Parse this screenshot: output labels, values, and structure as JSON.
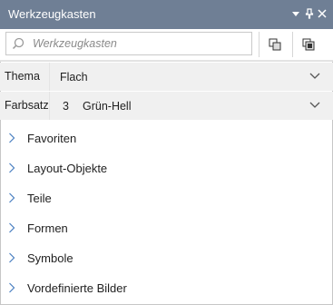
{
  "window": {
    "title": "Werkzeugkasten"
  },
  "search": {
    "placeholder": "Werkzeugkasten"
  },
  "properties": [
    {
      "label": "Thema",
      "value": "Flach"
    },
    {
      "label": "Farbsatz",
      "number": "3",
      "value": "Grün-Hell"
    }
  ],
  "categories": [
    {
      "label": "Favoriten"
    },
    {
      "label": "Layout-Objekte"
    },
    {
      "label": "Teile"
    },
    {
      "label": "Formen"
    },
    {
      "label": "Symbole"
    },
    {
      "label": "Vordefinierte Bilder"
    }
  ],
  "colors": {
    "titlebar": "#6f7f95",
    "panel": "#f0f0f0",
    "chevron_blue": "#4a7fc1"
  }
}
